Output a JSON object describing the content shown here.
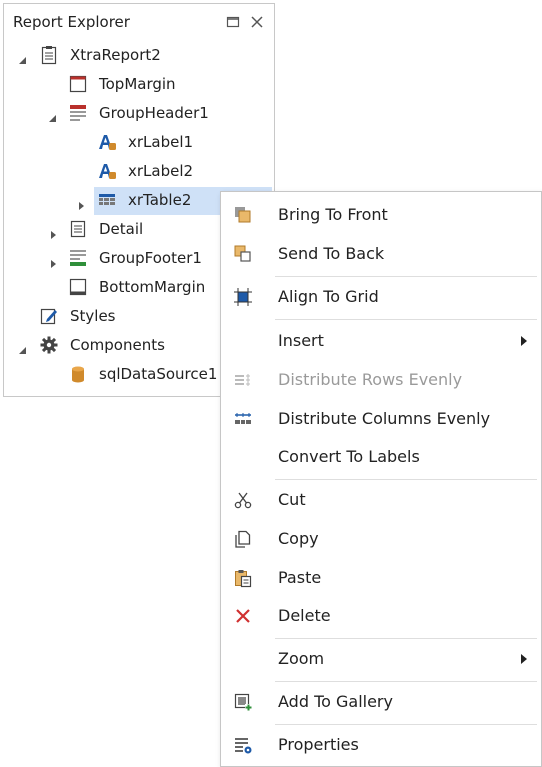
{
  "panel": {
    "title": "Report Explorer",
    "maximize_icon": "maximize-icon",
    "close_icon": "close-icon"
  },
  "tree": {
    "report": "XtraReport2",
    "top_margin": "TopMargin",
    "group_header": "GroupHeader1",
    "label1": "xrLabel1",
    "label2": "xrLabel2",
    "table": "xrTable2",
    "detail": "Detail",
    "group_footer": "GroupFooter1",
    "bottom_margin": "BottomMargin",
    "styles": "Styles",
    "components": "Components",
    "datasource": "sqlDataSource1"
  },
  "menu": {
    "bring_to_front": "Bring To Front",
    "send_to_back": "Send To Back",
    "align_to_grid": "Align To Grid",
    "insert": "Insert",
    "distribute_rows": "Distribute Rows Evenly",
    "distribute_columns": "Distribute Columns Evenly",
    "convert_to_labels": "Convert To Labels",
    "cut": "Cut",
    "copy": "Copy",
    "paste": "Paste",
    "delete": "Delete",
    "zoom": "Zoom",
    "add_to_gallery": "Add To Gallery",
    "properties": "Properties"
  },
  "colors": {
    "selection": "#cfe1f7",
    "accent_blue": "#1e5aa8",
    "header_red": "#b9302b",
    "footer_green": "#2f8f3a",
    "delete_red": "#d03030",
    "db_orange": "#d08a2c"
  }
}
